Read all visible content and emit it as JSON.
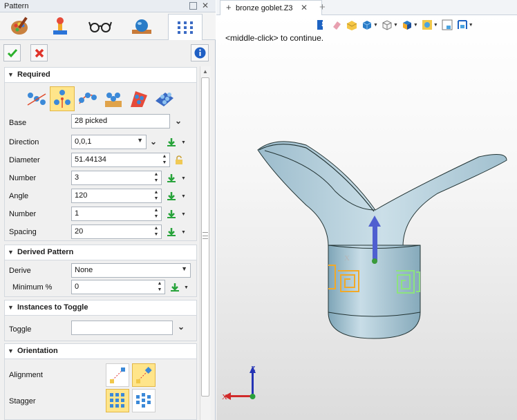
{
  "panel": {
    "title": "Pattern",
    "tabs": [
      {
        "icon": "palette-icon"
      },
      {
        "icon": "stamp-tool-icon"
      },
      {
        "icon": "glasses-icon"
      },
      {
        "icon": "sphere-on-base-icon"
      },
      {
        "icon": "pattern-dots-icon",
        "active": true
      }
    ],
    "info_icon": "info-icon"
  },
  "required": {
    "header": "Required",
    "pattern_types": [
      "linear-pattern-icon",
      "circular-pattern-icon",
      "pattern-along-curve-icon",
      "pattern-on-face-icon",
      "pattern-fill-icon",
      "variable-pattern-icon"
    ],
    "selected_type_index": 1,
    "base": {
      "label": "Base",
      "value": "28 picked"
    },
    "direction": {
      "label": "Direction",
      "value": "0,0,1"
    },
    "diameter": {
      "label": "Diameter",
      "value": "51.44134"
    },
    "number1": {
      "label": "Number",
      "value": "3"
    },
    "angle": {
      "label": "Angle",
      "value": "120"
    },
    "number2": {
      "label": "Number",
      "value": "1"
    },
    "spacing": {
      "label": "Spacing",
      "value": "20"
    }
  },
  "derived": {
    "header": "Derived Pattern",
    "derive": {
      "label": "Derive",
      "value": "None"
    },
    "minimum": {
      "label": "Minimum %",
      "value": "0"
    }
  },
  "toggle": {
    "header": "Instances to Toggle",
    "toggle": {
      "label": "Toggle",
      "value": ""
    }
  },
  "orientation": {
    "header": "Orientation",
    "alignment": {
      "label": "Alignment"
    },
    "stagger": {
      "label": "Stagger"
    }
  },
  "document": {
    "tab_name": "bronze goblet.Z3",
    "hint": "<middle-click> to continue."
  },
  "colors": {
    "accent_selected": "#ffe58a",
    "model": "#a9c6d6",
    "arrow": "#4f5fd0",
    "decal_orange": "#f1a928",
    "decal_green": "#8de37f"
  }
}
